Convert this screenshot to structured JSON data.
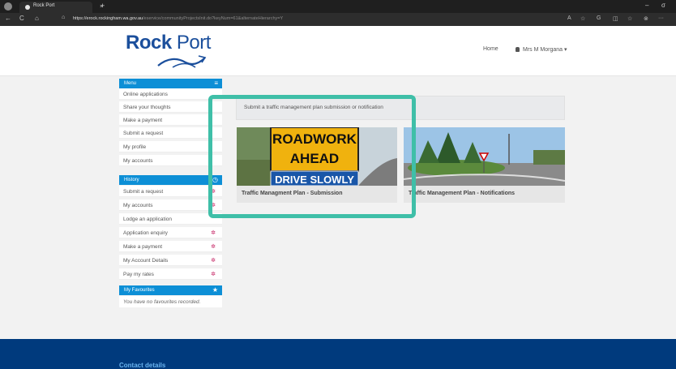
{
  "browser": {
    "tab_title": "Rock Port",
    "tab_close": "×",
    "new_tab": "+",
    "url_domain": "https://erock.rockingham.wa.gov.au",
    "url_path": "/eservice/communityProjectsInit.do?keyNum=61&alternateHierarchy=Y",
    "nav_back": "←",
    "nav_reload": "C",
    "nav_home": "⌂",
    "lock": "⌂",
    "tool_read": "A",
    "tool_fav": "☆",
    "tool_ext": "G",
    "tool_split": "◫",
    "tool_favs": "☆",
    "tool_other": "⊗",
    "tool_more": "···",
    "win_min": "–",
    "win_max": "σ"
  },
  "header": {
    "logo_bold": "Rock",
    "logo_light": " Port",
    "nav_home": "Home",
    "user_icon": "person-icon",
    "user_name": "Mrs M Morgana",
    "user_caret": "▾"
  },
  "sidebar": {
    "menu_title": "Menu",
    "menu_items": [
      {
        "label": "Online applications"
      },
      {
        "label": "Share your thoughts"
      },
      {
        "label": "Make a payment"
      },
      {
        "label": "Submit a request"
      },
      {
        "label": "My profile"
      },
      {
        "label": "My accounts"
      }
    ],
    "history_title": "History",
    "history_items": [
      {
        "label": "Submit a request",
        "starred": true
      },
      {
        "label": "My accounts",
        "starred": true
      },
      {
        "label": "Lodge an application",
        "starred": false
      },
      {
        "label": "Application enquiry",
        "starred": true
      },
      {
        "label": "Make a payment",
        "starred": true
      },
      {
        "label": "My Account Details",
        "starred": true
      },
      {
        "label": "Pay my rates",
        "starred": true
      }
    ],
    "favourites_title": "My Favourites",
    "favourites_empty": "You have no favourites recorded."
  },
  "main": {
    "notice": "Submit a traffic management plan submission or notification",
    "cards": [
      {
        "label": "Traffic Managment Plan - Submission",
        "sign_line1": "ROADWORK",
        "sign_line2": "AHEAD",
        "sign_line3": "DRIVE SLOWLY"
      },
      {
        "label": "Traffic Management Plan - Notifications"
      }
    ]
  },
  "footer": {
    "contact_title": "Contact details"
  },
  "colors": {
    "brand_blue": "#1b4f9c",
    "panel_blue": "#0d8fd6",
    "highlight_teal": "#3fbfa8",
    "footer_navy": "#003a7d"
  }
}
